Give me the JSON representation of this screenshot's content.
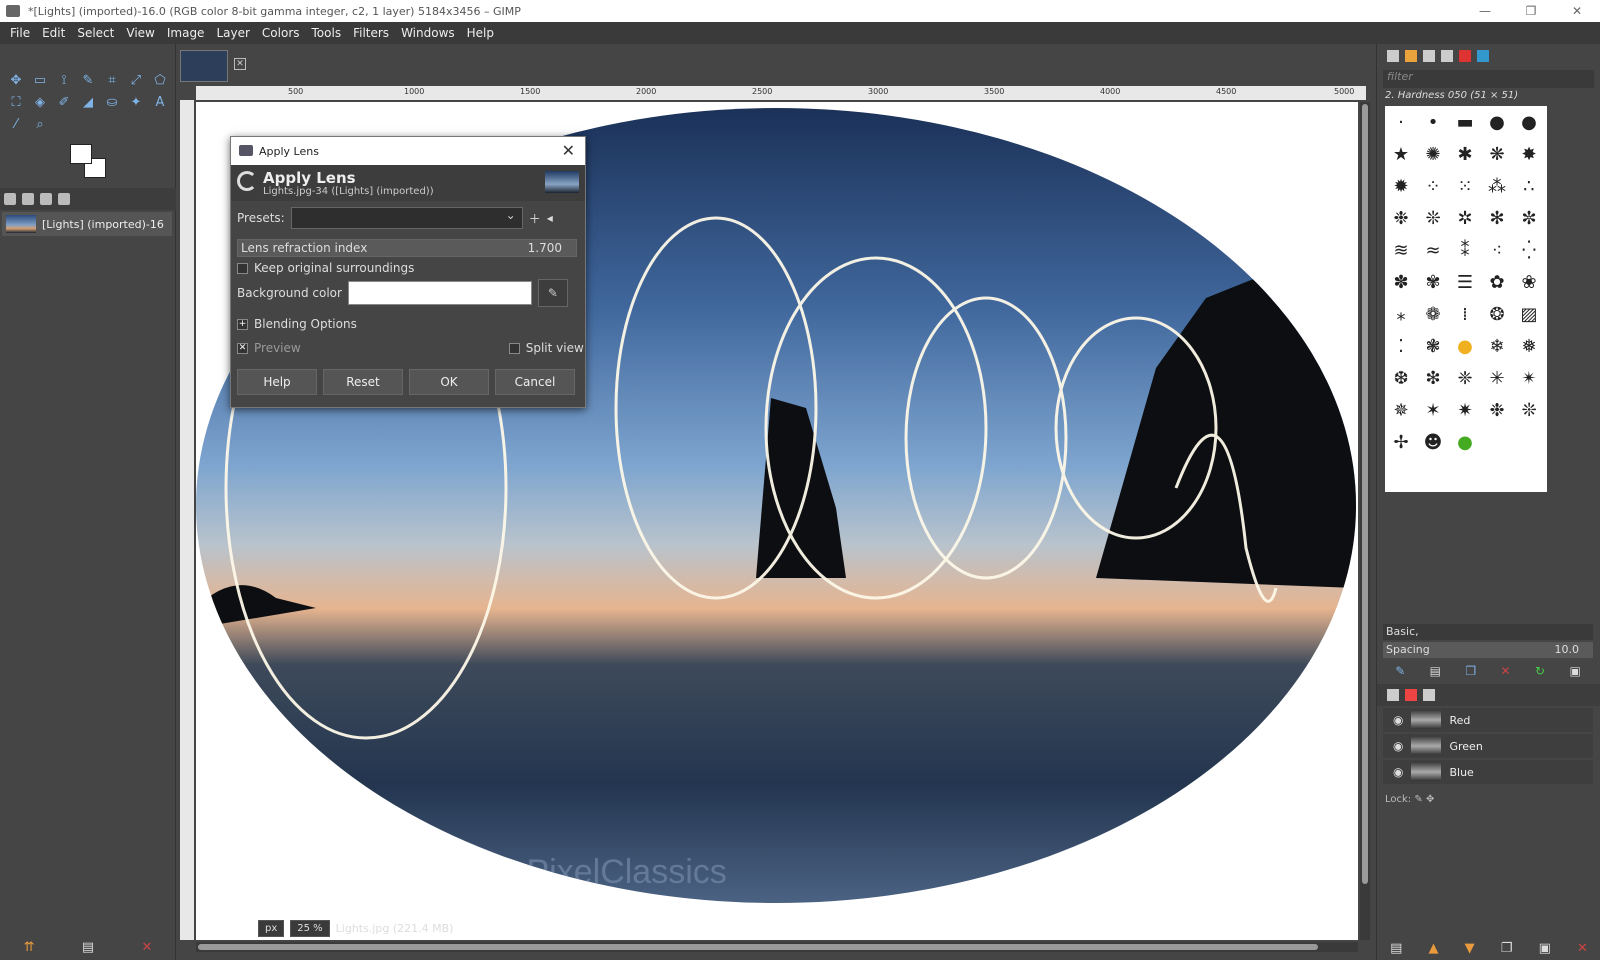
{
  "window": {
    "title": "*[Lights] (imported)-16.0 (RGB color 8-bit gamma integer, c2, 1 layer) 5184x3456 – GIMP",
    "controls": [
      "—",
      "❐",
      "✕"
    ]
  },
  "menu": [
    "File",
    "Edit",
    "Select",
    "View",
    "Image",
    "Layer",
    "Colors",
    "Tools",
    "Filters",
    "Windows",
    "Help"
  ],
  "tools": [
    "✥",
    "▭",
    "⟟",
    "✎",
    "⌗",
    "⤢",
    "⬠",
    "⛶",
    "◈",
    "✐",
    "◢",
    "⛀",
    "✦",
    "⌖",
    "A",
    "⁄",
    "⌕"
  ],
  "images_panel": {
    "item": "[Lights] (imported)-16"
  },
  "ruler": [
    "500",
    "1000",
    "1500",
    "2000",
    "2500",
    "3000",
    "3500",
    "4000",
    "4500",
    "5000"
  ],
  "canvas": {
    "watermark": "© PixelClassics"
  },
  "dialog": {
    "window_title": "Apply Lens",
    "heading": "Apply Lens",
    "subheading": "Lights.jpg-34 ([Lights] (imported))",
    "presets_label": "Presets:",
    "lens_label": "Lens refraction index",
    "lens_value": "1.700",
    "keep_label": "Keep original surroundings",
    "bg_label": "Background color",
    "blending_label": "Blending Options",
    "preview_label": "Preview",
    "split_label": "Split view",
    "buttons": [
      "Help",
      "Reset",
      "OK",
      "Cancel"
    ]
  },
  "status": {
    "unit": "px",
    "zoom": "25 %",
    "file": "Lights.jpg (221.4 MB)"
  },
  "brushes": {
    "filter_placeholder": "filter",
    "brush_name": "2. Hardness 050 (51 × 51)",
    "preset": "Basic,",
    "spacing_label": "Spacing",
    "spacing_value": "10.0"
  },
  "channels": [
    "Red",
    "Green",
    "Blue"
  ],
  "lock_label": "Lock:"
}
